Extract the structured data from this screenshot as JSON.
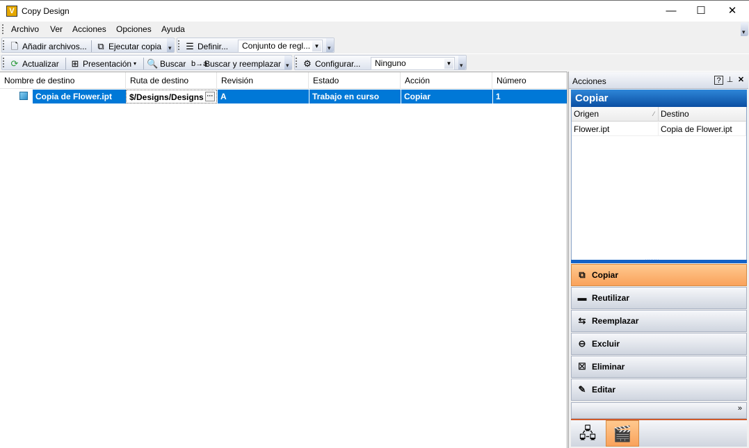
{
  "window": {
    "title": "Copy Design",
    "app_icon_letter": "V",
    "minimize": "—",
    "maximize": "☐",
    "close": "✕"
  },
  "menu": {
    "items": [
      "Archivo",
      "Ver",
      "Acciones",
      "Opciones",
      "Ayuda"
    ]
  },
  "toolbar1": {
    "add_files": "Añadir archivos...",
    "run_copy": "Ejecutar copia",
    "define": "Definir...",
    "ruleset_combo": "Conjunto de regl..."
  },
  "toolbar2": {
    "refresh": "Actualizar",
    "presentation": "Presentación",
    "search": "Buscar",
    "search_replace": "Buscar y reemplazar",
    "configure": "Configurar...",
    "none_combo": "Ninguno"
  },
  "grid": {
    "columns": [
      "Nombre de destino",
      "Ruta de destino",
      "Revisión",
      "Estado",
      "Acción",
      "Número"
    ],
    "rows": [
      {
        "name": "Copia de Flower.ipt",
        "path": "$/Designs/Designs",
        "revision": "A",
        "state": "Trabajo en curso",
        "action": "Copiar",
        "number": "1"
      }
    ]
  },
  "panel": {
    "title": "Acciones",
    "help": "?",
    "pin": "⊥",
    "close": "✕",
    "section": "Copiar",
    "list_columns": [
      "Origen",
      "Destino"
    ],
    "list_rows": [
      {
        "origin": "Flower.ipt",
        "dest": "Copia de Flower.ipt"
      }
    ],
    "actions": [
      {
        "label": "Copiar",
        "icon": "copy-icon",
        "glyph": "⧉",
        "active": true
      },
      {
        "label": "Reutilizar",
        "icon": "reuse-icon",
        "glyph": "▬",
        "active": false
      },
      {
        "label": "Reemplazar",
        "icon": "replace-icon",
        "glyph": "⇆",
        "active": false
      },
      {
        "label": "Excluir",
        "icon": "exclude-icon",
        "glyph": "⊖",
        "active": false
      },
      {
        "label": "Eliminar",
        "icon": "delete-icon",
        "glyph": "☒",
        "active": false
      },
      {
        "label": "Editar",
        "icon": "edit-icon",
        "glyph": "✎",
        "active": false
      }
    ],
    "more": "»"
  },
  "colors": {
    "selection": "#0078d7",
    "accent_orange": "#f9a25b",
    "panel_header_blue": "#0b4fa2"
  }
}
